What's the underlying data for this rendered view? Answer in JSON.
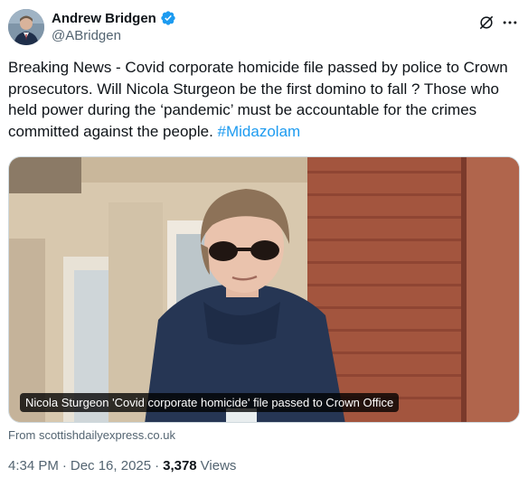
{
  "author": {
    "name": "Andrew Bridgen",
    "handle": "@ABridgen",
    "verified_color": "#1d9bf0"
  },
  "actions": {
    "grok_icon": "grok-icon",
    "more_icon": "more-icon"
  },
  "tweet": {
    "text": "Breaking News - Covid corporate homicide file passed by police to Crown prosecutors. Will Nicola Sturgeon be the first domino to fall ? Those who held power during the ‘pandemic’ must be accountable for the crimes committed against the people. ",
    "hashtag": "#Midazolam"
  },
  "media": {
    "caption": "Nicola Sturgeon 'Covid corporate homicide' file passed to Crown Office"
  },
  "source": "From scottishdailyexpress.co.uk",
  "meta": {
    "time": "4:34 PM",
    "separator1": "·",
    "date": "Dec 16, 2025",
    "separator2": "·",
    "views_count": "3,378",
    "views_label": "Views"
  },
  "colors": {
    "link": "#1d9bf0",
    "secondary": "#536471",
    "primary": "#0f1419"
  }
}
